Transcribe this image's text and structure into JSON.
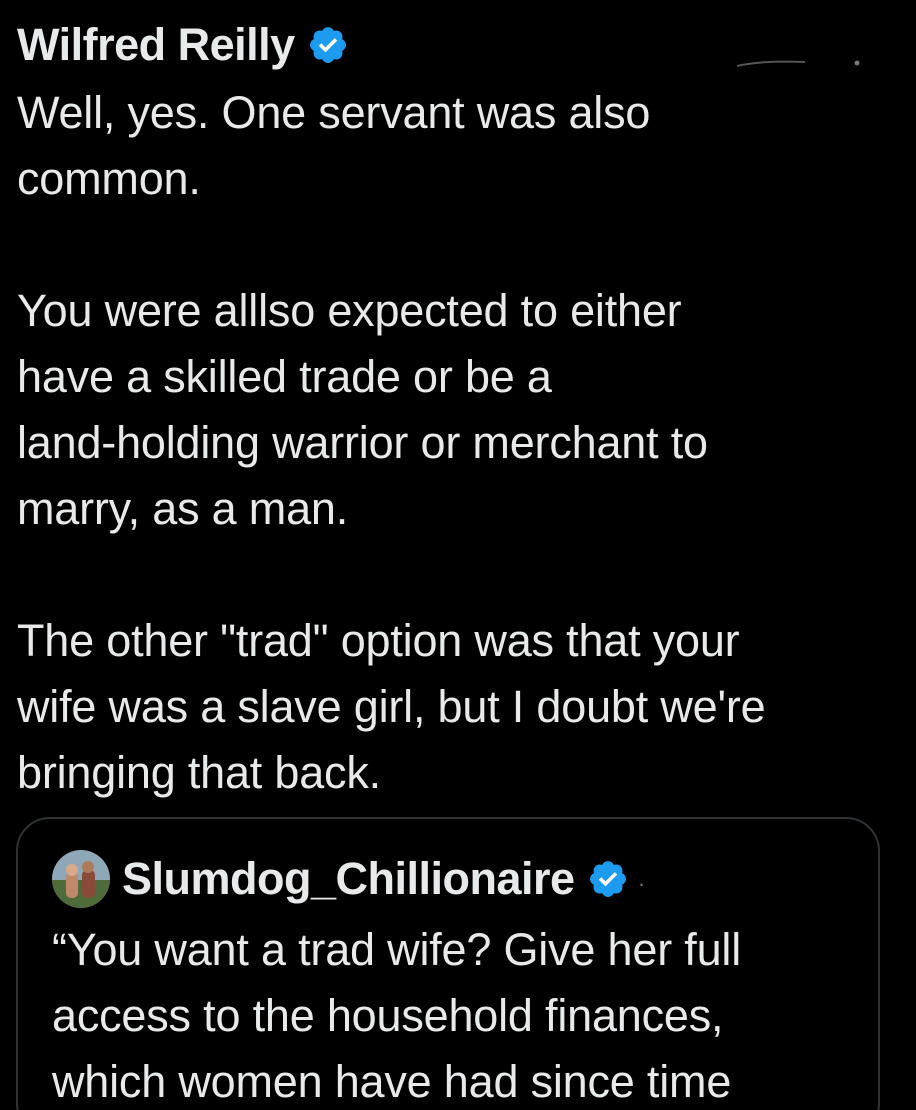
{
  "tweet": {
    "author_name": "Wilfred Reilly",
    "verified_icon": "verified-badge-icon",
    "text": "Well, yes. One servant was also\ncommon.\n\nYou were alllso expected to either\nhave a skilled trade or be a\nland-holding warrior or merchant to\nmarry, as a man.\n\nThe other \"trad\" option was that your\nwife was a slave girl, but I doubt we're\nbringing that back."
  },
  "quote": {
    "author_name": "Slumdog_Chillionaire",
    "verified_icon": "verified-badge-icon",
    "more_indicator": ".",
    "text": "“You want a trad wife? Give her full\naccess to the household finances,\nwhich women have had since time"
  },
  "colors": {
    "background": "#000000",
    "text": "#e7e9ea",
    "verified_blue": "#1d9bf0",
    "card_border": "#2f3336"
  }
}
